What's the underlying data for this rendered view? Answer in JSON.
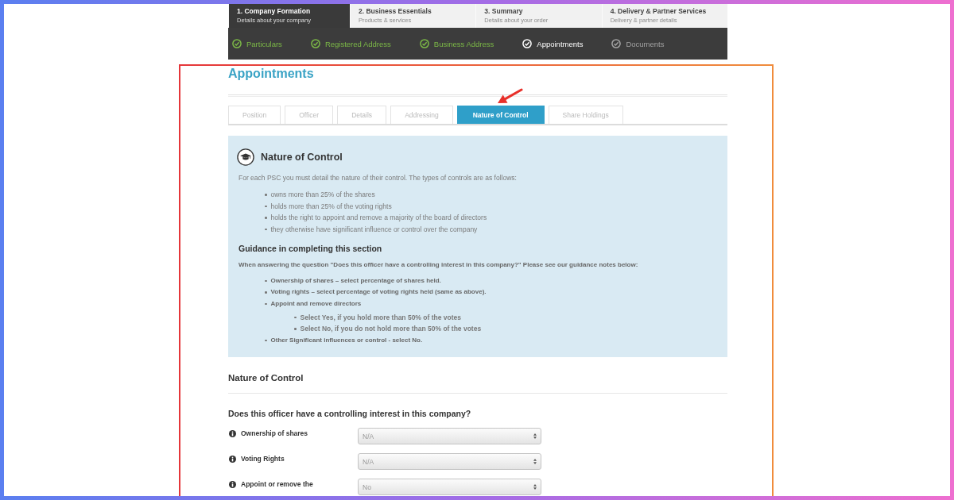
{
  "steps": [
    {
      "title": "1. Company Formation",
      "subtitle": "Details about your company",
      "selected": true
    },
    {
      "title": "2. Business Essentials",
      "subtitle": "Products & services",
      "selected": false
    },
    {
      "title": "3. Summary",
      "subtitle": "Details about your order",
      "selected": false
    },
    {
      "title": "4. Delivery & Partner Services",
      "subtitle": "Delivery & partner details",
      "selected": false
    }
  ],
  "progress": [
    {
      "label": "Particulars",
      "completed": true,
      "selected": false
    },
    {
      "label": "Registered Address",
      "completed": true,
      "selected": false
    },
    {
      "label": "Business Address",
      "completed": true,
      "selected": false
    },
    {
      "label": "Appointments",
      "completed": false,
      "selected": true
    },
    {
      "label": "Documents",
      "completed": false,
      "selected": false
    }
  ],
  "section": {
    "heading": "Appointments",
    "tabs": [
      {
        "label": "Position",
        "selected": false
      },
      {
        "label": "Officer",
        "selected": false
      },
      {
        "label": "Details",
        "selected": false
      },
      {
        "label": "Addressing",
        "selected": false
      },
      {
        "label": "Nature of Control",
        "selected": true
      },
      {
        "label": "Share Holdings",
        "selected": false
      }
    ]
  },
  "info_panel": {
    "title": "Nature of Control",
    "intro": "For each PSC you must detail the nature of their control. The types of controls are as follows:",
    "items": [
      "owns more than 25% of the shares",
      "holds more than 25% of the voting rights",
      "holds the right to appoint and remove a majority of the board of directors",
      "they otherwise have significant influence or control over the company"
    ],
    "guidance_title": "Guidance in completing this section",
    "guidance_intro": "When answering the question \"Does this officer have a controlling interest in this company?\" Please see our guidance notes below:",
    "guidance_items": [
      {
        "text": "Ownership of shares – select percentage of shares held."
      },
      {
        "text": "Voting rights – select percentage of voting rights held (same as above)."
      },
      {
        "text": "Appoint and remove directors",
        "children": [
          {
            "text": "Select Yes, if you hold more than 50% of the votes"
          },
          {
            "text": "Select No, if you do not hold more than 50% of the votes"
          }
        ]
      },
      {
        "text": "Other Significant influences or control - select No."
      }
    ]
  },
  "form": {
    "heading": "Nature of Control",
    "question": "Does this officer have a controlling interest in this company?",
    "fields": [
      {
        "label": "Ownership of shares",
        "value": "N/A"
      },
      {
        "label": "Voting Rights",
        "value": "N/A"
      },
      {
        "label": "Appoint or remove the",
        "value": "No"
      }
    ]
  }
}
